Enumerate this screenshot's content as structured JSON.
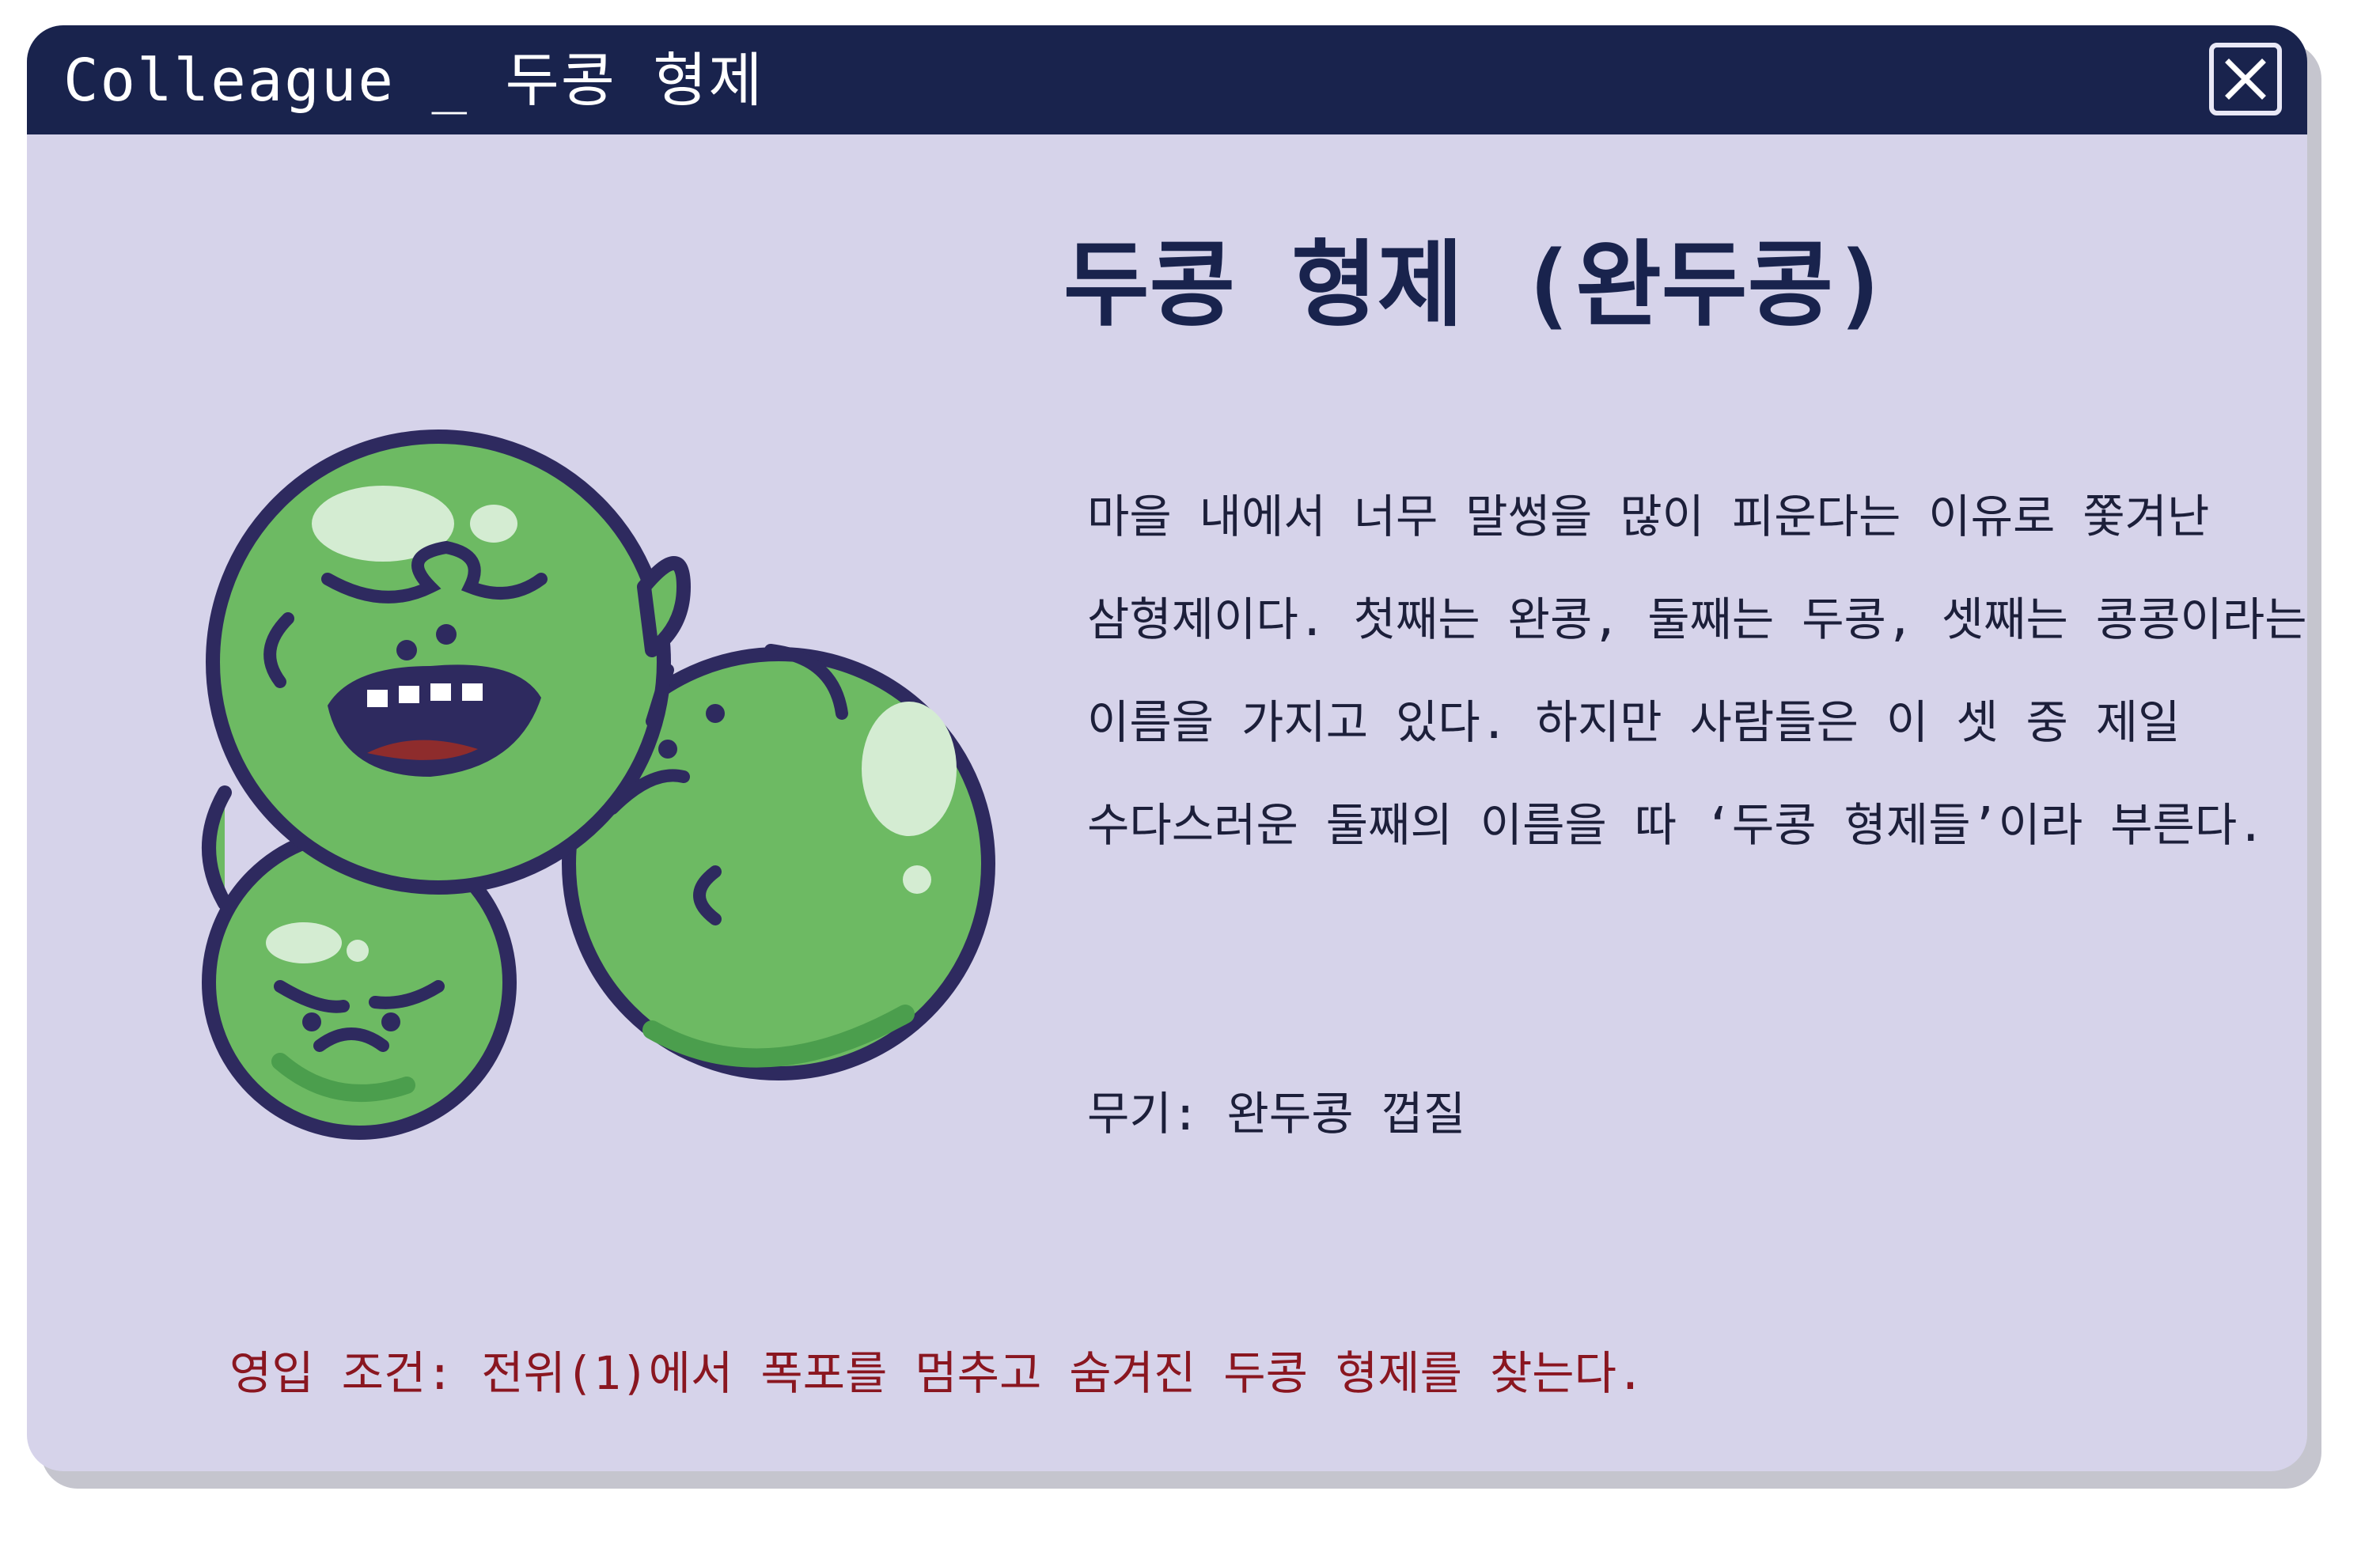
{
  "window": {
    "title": "Colleague _ 두콩 형제",
    "close_icon": "close-x-icon"
  },
  "colleague": {
    "name": "두콩 형제 (완두콩)",
    "portrait": "three-green-peas-icon",
    "description_lines": [
      "마을 내에서 너무 말썽을 많이 피운다는 이유로 쫓겨난",
      "삼형제이다. 첫째는 완콩, 둘째는 두콩, 셋째는 콩콩이라는",
      "이름을 가지고 있다. 하지만 사람들은 이 셋 중 제일",
      "수다스러운 둘째의 이름을 따 ‘두콩 형제들’이라 부른다."
    ],
    "weapon": "무기: 완두콩 껍질",
    "recruit_condition": "영입 조건: 전위(1)에서 폭포를 멈추고 숨겨진 두콩 형제를 찾는다."
  },
  "colors": {
    "titlebar": "#19234d",
    "window_bg": "#d6d3ea",
    "condition_text": "#8a1620",
    "pea_green": "#6dba63",
    "outline": "#2e2a5f"
  }
}
